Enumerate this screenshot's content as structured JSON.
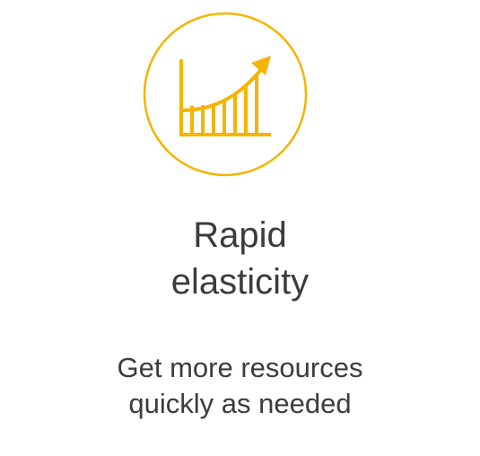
{
  "feature": {
    "icon": "growth-chart-icon",
    "accent_color": "#F4B400",
    "title_lines": [
      "Rapid",
      "elasticity"
    ],
    "description_lines": [
      "Get more resources",
      "quickly as needed"
    ]
  }
}
